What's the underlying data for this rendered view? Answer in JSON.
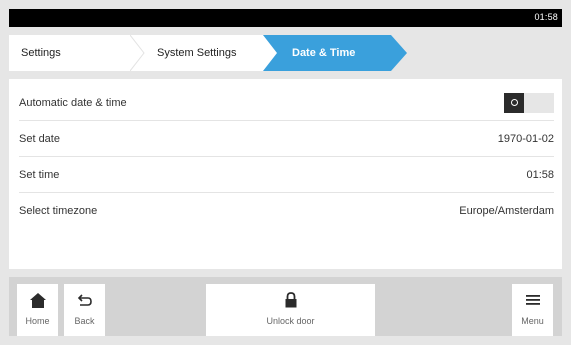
{
  "status_bar": {
    "time": "01:58"
  },
  "breadcrumb": {
    "items": [
      "Settings",
      "System Settings",
      "Date & Time"
    ],
    "active_color": "#3aa0dc"
  },
  "settings": {
    "automatic_label": "Automatic date & time",
    "automatic_enabled": false,
    "set_date_label": "Set date",
    "set_date_value": "1970-01-02",
    "set_time_label": "Set time",
    "set_time_value": "01:58",
    "timezone_label": "Select timezone",
    "timezone_value": "Europe/Amsterdam"
  },
  "bottom_bar": {
    "home_label": "Home",
    "home_icon": "home-icon",
    "back_label": "Back",
    "back_icon": "back-arrow-icon",
    "unlock_label": "Unlock door",
    "unlock_icon": "lock-icon",
    "menu_label": "Menu",
    "menu_icon": "menu-icon"
  }
}
